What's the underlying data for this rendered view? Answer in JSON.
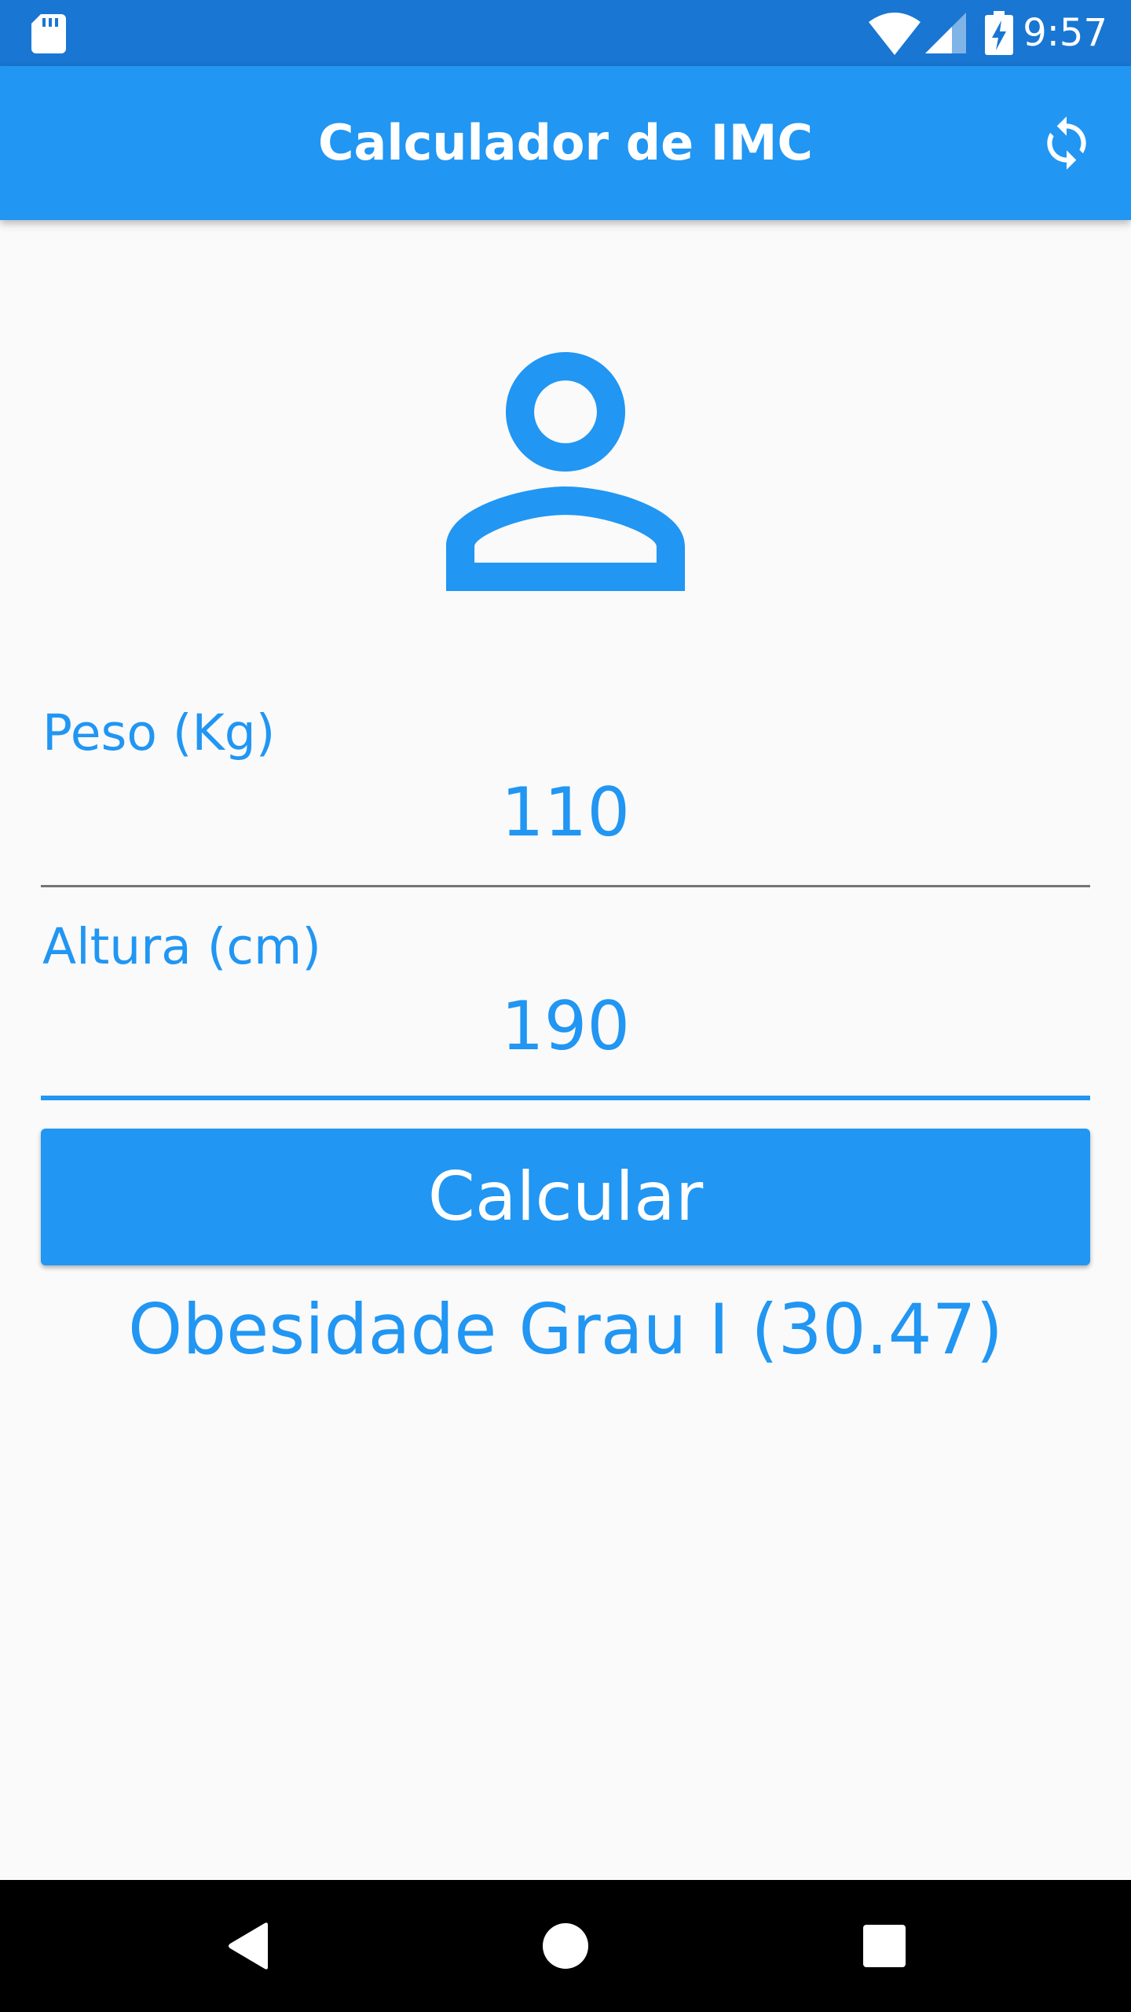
{
  "status_bar": {
    "time": "9:57",
    "icons": [
      "sd-card-icon",
      "wifi-icon",
      "cell-signal-icon",
      "battery-charging-icon"
    ]
  },
  "app_bar": {
    "title": "Calculador de IMC",
    "action_icon": "refresh-icon"
  },
  "avatar_icon": "person-outline-icon",
  "form": {
    "weight": {
      "label": "Peso (Kg)",
      "value": "110"
    },
    "height": {
      "label": "Altura (cm)",
      "value": "190"
    },
    "calculate_label": "Calcular"
  },
  "result_text": "Obesidade Grau I (30.47)",
  "navigation": {
    "icons": [
      "back-icon",
      "home-icon",
      "recents-icon"
    ]
  },
  "colors": {
    "primary": "#2196f3",
    "primary_dark": "#1976d2",
    "background": "#fafafa",
    "underline_inactive": "#757575",
    "nav_bar": "#000000"
  }
}
